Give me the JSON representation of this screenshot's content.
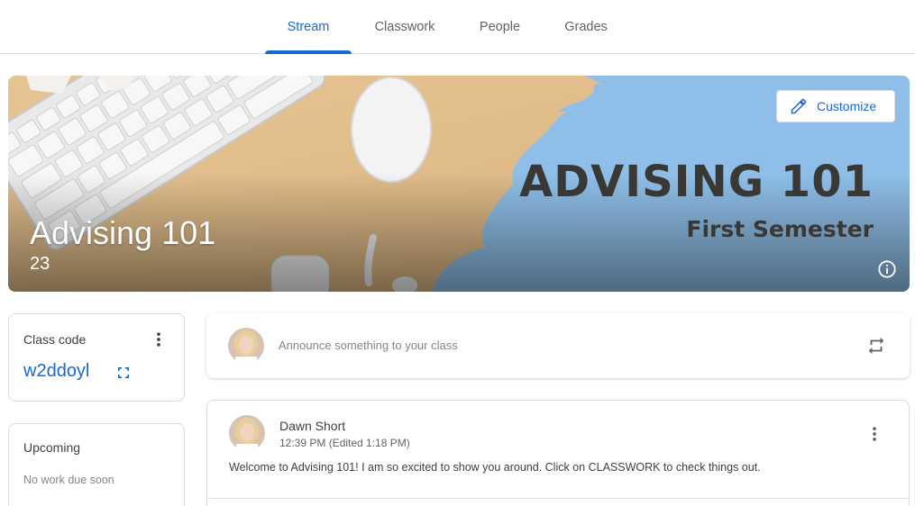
{
  "tabs": [
    {
      "label": "Stream",
      "active": true
    },
    {
      "label": "Classwork",
      "active": false
    },
    {
      "label": "People",
      "active": false
    },
    {
      "label": "Grades",
      "active": false
    }
  ],
  "banner": {
    "title": "Advising 101",
    "section": "23",
    "customize_label": "Customize",
    "art_title": "ADVISING 101",
    "art_subtitle": "First Semester",
    "colors": {
      "tan": "#e9c99a",
      "blue": "#8fbfe8",
      "dark_text": "#3a3835"
    }
  },
  "class_code": {
    "label": "Class code",
    "code": "w2ddoyl"
  },
  "upcoming": {
    "label": "Upcoming",
    "status": "No work due soon"
  },
  "announce": {
    "placeholder": "Announce something to your class"
  },
  "post": {
    "author": "Dawn Short",
    "time": "12:39 PM (Edited 1:18 PM)",
    "body": "Welcome to Advising 101! I am so excited to show you around. Click on CLASSWORK to check things out."
  },
  "icons": {
    "customize": "pencil-icon",
    "info": "info-icon",
    "menu": "more-vert-icon",
    "fullscreen": "fullscreen-icon",
    "repost": "repeat-icon"
  },
  "accent_color": "#1967d2"
}
